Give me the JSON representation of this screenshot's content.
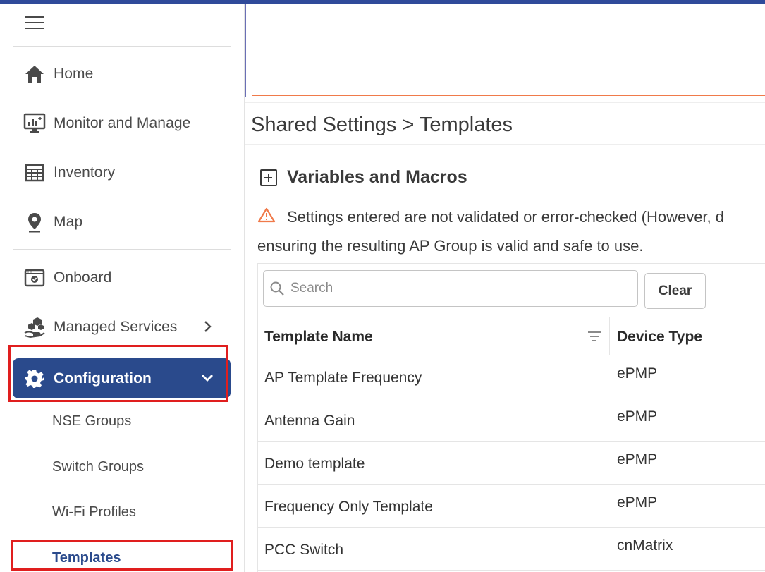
{
  "sidebar": {
    "nav": [
      {
        "label": "Home",
        "icon": "home-icon"
      },
      {
        "label": "Monitor and Manage",
        "icon": "monitor-icon"
      },
      {
        "label": "Inventory",
        "icon": "inventory-grid-icon"
      },
      {
        "label": "Map",
        "icon": "map-pin-icon"
      },
      {
        "label": "Onboard",
        "icon": "onboard-icon"
      },
      {
        "label": "Managed Services",
        "icon": "managed-services-icon"
      },
      {
        "label": "Configuration",
        "icon": "gear-icon"
      }
    ],
    "sub_items": [
      "NSE Groups",
      "Switch Groups",
      "Wi-Fi Profiles",
      "Templates"
    ],
    "active_color": "#2a4a8c",
    "highlight_color": "#e01e1e"
  },
  "main": {
    "breadcrumb": "Shared Settings > Templates",
    "section_title": "Variables and Macros",
    "warning_line1": "Settings entered are not validated or error-checked (However, d",
    "warning_line2": "ensuring the resulting AP Group is valid and safe to use.",
    "warning_color": "#f07a4a",
    "search_placeholder": "Search",
    "clear_label": "Clear",
    "columns": [
      "Template Name",
      "Device Type"
    ],
    "rows": [
      {
        "name": "AP Template Frequency",
        "device_type": "ePMP"
      },
      {
        "name": "Antenna Gain",
        "device_type": "ePMP"
      },
      {
        "name": "Demo template",
        "device_type": "ePMP"
      },
      {
        "name": "Frequency Only Template",
        "device_type": "ePMP"
      },
      {
        "name": "PCC Switch",
        "device_type": "cnMatrix"
      }
    ]
  }
}
